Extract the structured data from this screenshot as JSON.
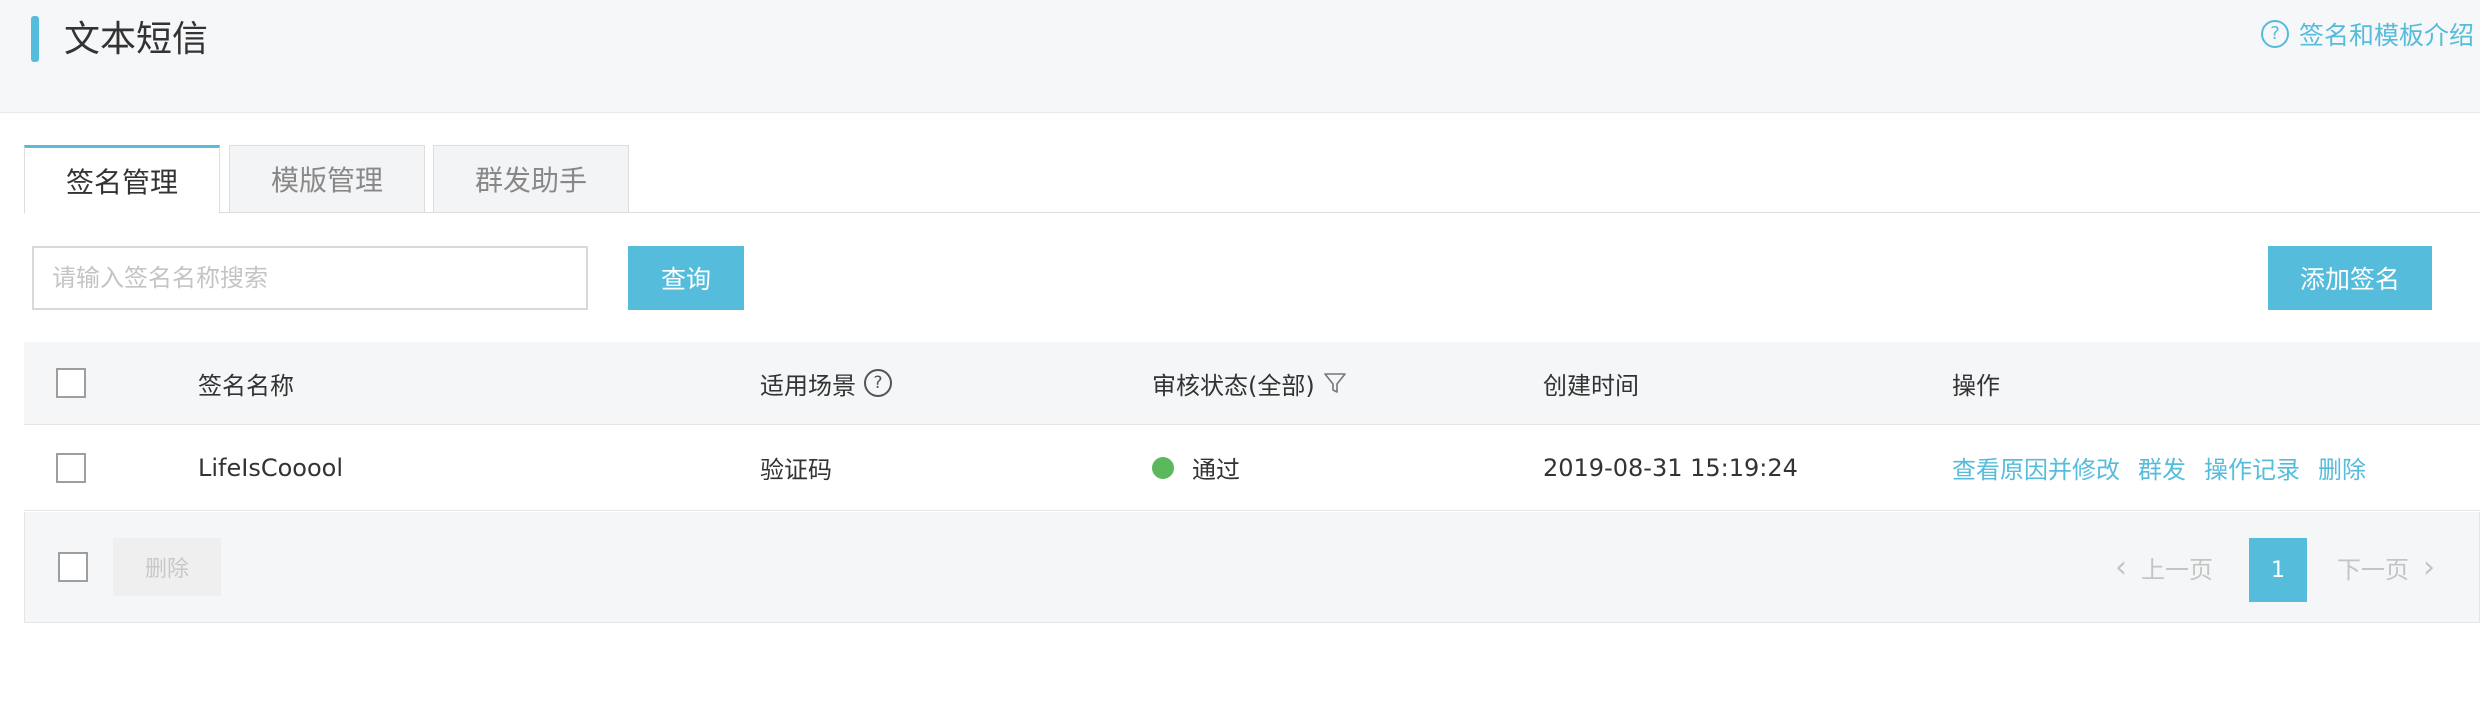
{
  "header": {
    "title": "文本短信",
    "intro_link": "签名和模板介绍",
    "intro_icon": "question-circle-icon",
    "accent_color": "#56bcdb"
  },
  "tabs": [
    {
      "label": "签名管理",
      "active": true
    },
    {
      "label": "模版管理",
      "active": false
    },
    {
      "label": "群发助手",
      "active": false
    }
  ],
  "search": {
    "placeholder": "请输入签名名称搜索",
    "value": "",
    "query_label": "查询",
    "add_label": "添加签名"
  },
  "table": {
    "columns": {
      "name": "签名名称",
      "scene": "适用场景",
      "status": "审核状态(全部)",
      "created": "创建时间",
      "ops": "操作"
    },
    "rows": [
      {
        "name": "LifeIsCooool",
        "scene": "验证码",
        "status": "通过",
        "status_color": "#5cb85c",
        "created": "2019-08-31 15:19:24",
        "ops": [
          "查看原因并修改",
          "群发",
          "操作记录",
          "删除"
        ]
      }
    ]
  },
  "footer": {
    "delete_label": "删除",
    "prev_label": "上一页",
    "next_label": "下一页",
    "current_page": "1"
  }
}
